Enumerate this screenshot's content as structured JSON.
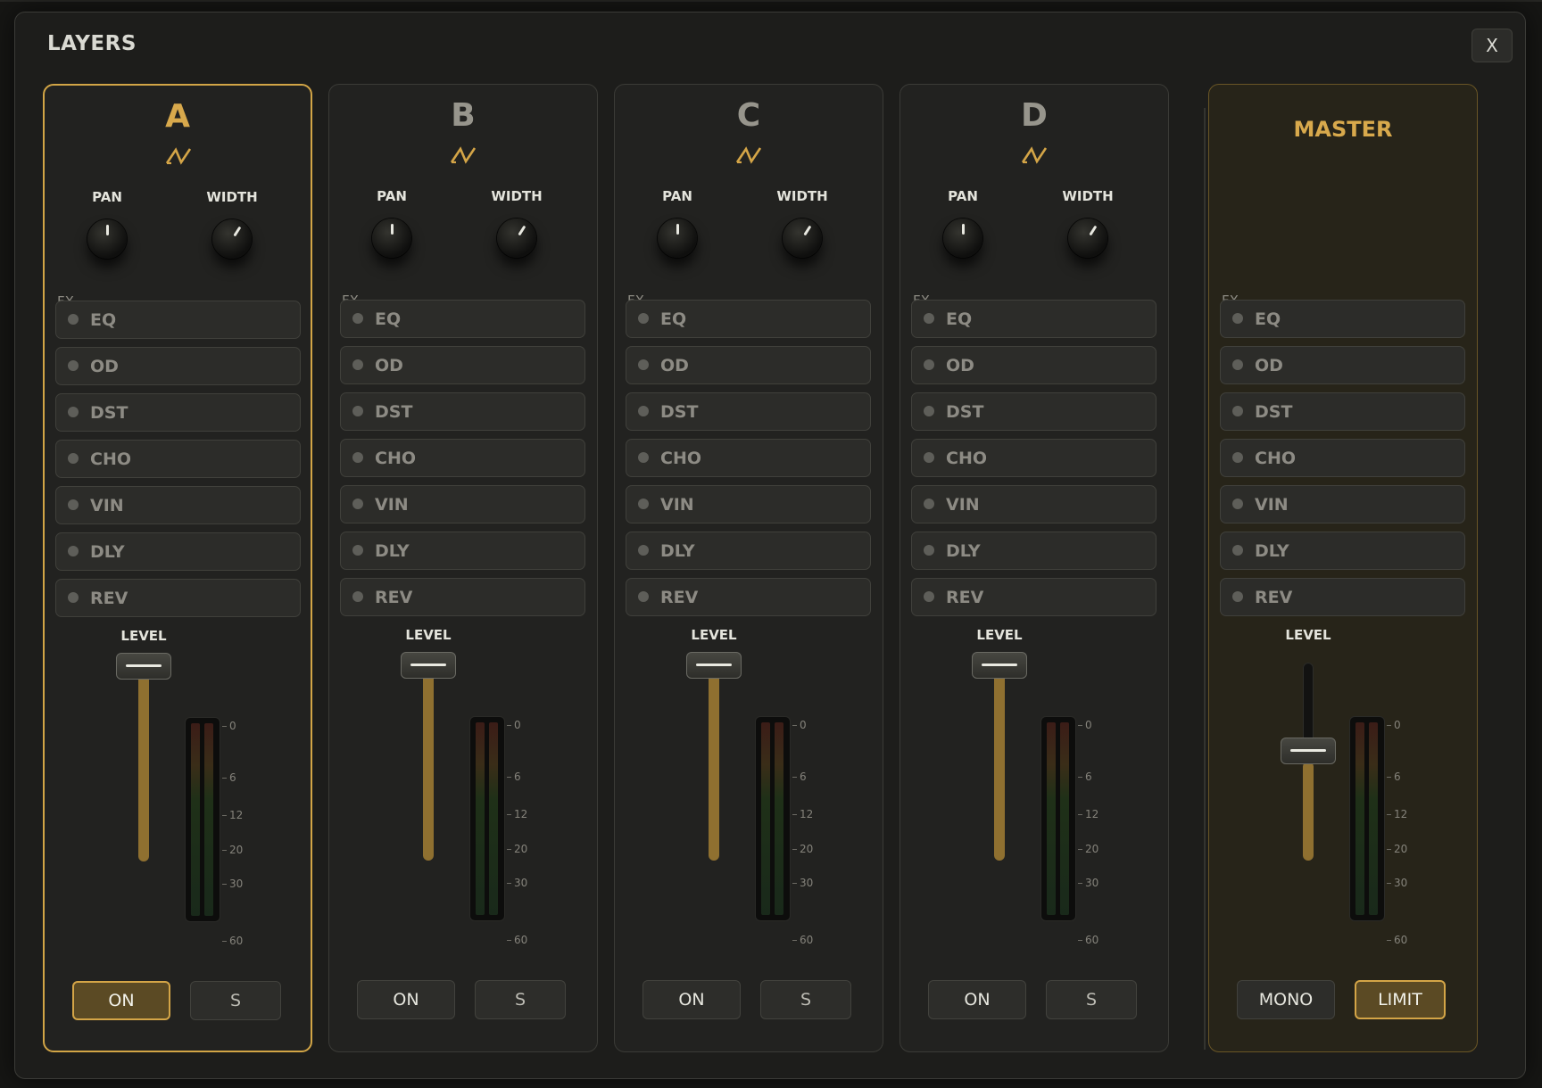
{
  "dialog": {
    "title": "LAYERS",
    "close_label": "X"
  },
  "channels": [
    {
      "name": "A",
      "selected": true,
      "pan_label": "PAN",
      "width_label": "WIDTH",
      "pan_value": 0.5,
      "width_value": 0.62,
      "fx_label": "FX",
      "fx": [
        "EQ",
        "OD",
        "DST",
        "CHO",
        "VIN",
        "DLY",
        "REV"
      ],
      "level_label": "LEVEL",
      "level_value": 1.0,
      "scale": [
        "0",
        "6",
        "12",
        "20",
        "30",
        "60"
      ],
      "on_label": "ON",
      "on_active": true,
      "solo_label": "S"
    },
    {
      "name": "B",
      "selected": false,
      "pan_label": "PAN",
      "width_label": "WIDTH",
      "pan_value": 0.5,
      "width_value": 0.62,
      "fx_label": "FX",
      "fx": [
        "EQ",
        "OD",
        "DST",
        "CHO",
        "VIN",
        "DLY",
        "REV"
      ],
      "level_label": "LEVEL",
      "level_value": 1.0,
      "scale": [
        "0",
        "6",
        "12",
        "20",
        "30",
        "60"
      ],
      "on_label": "ON",
      "on_active": false,
      "solo_label": "S"
    },
    {
      "name": "C",
      "selected": false,
      "pan_label": "PAN",
      "width_label": "WIDTH",
      "pan_value": 0.5,
      "width_value": 0.62,
      "fx_label": "FX",
      "fx": [
        "EQ",
        "OD",
        "DST",
        "CHO",
        "VIN",
        "DLY",
        "REV"
      ],
      "level_label": "LEVEL",
      "level_value": 1.0,
      "scale": [
        "0",
        "6",
        "12",
        "20",
        "30",
        "60"
      ],
      "on_label": "ON",
      "on_active": false,
      "solo_label": "S"
    },
    {
      "name": "D",
      "selected": false,
      "pan_label": "PAN",
      "width_label": "WIDTH",
      "pan_value": 0.5,
      "width_value": 0.62,
      "fx_label": "FX",
      "fx": [
        "EQ",
        "OD",
        "DST",
        "CHO",
        "VIN",
        "DLY",
        "REV"
      ],
      "level_label": "LEVEL",
      "level_value": 1.0,
      "scale": [
        "0",
        "6",
        "12",
        "20",
        "30",
        "60"
      ],
      "on_label": "ON",
      "on_active": false,
      "solo_label": "S"
    }
  ],
  "master": {
    "name": "MASTER",
    "fx_label": "FX",
    "fx": [
      "EQ",
      "OD",
      "DST",
      "CHO",
      "VIN",
      "DLY",
      "REV"
    ],
    "level_label": "LEVEL",
    "level_value": 0.5,
    "scale": [
      "0",
      "6",
      "12",
      "20",
      "30",
      "60"
    ],
    "mono_label": "MONO",
    "mono_active": false,
    "limit_label": "LIMIT",
    "limit_active": true
  },
  "colors": {
    "accent": "#d4a547",
    "fader_fill": "#8f7030",
    "panel": "#222220"
  },
  "icons": {
    "channel_source": "wave-icon"
  }
}
